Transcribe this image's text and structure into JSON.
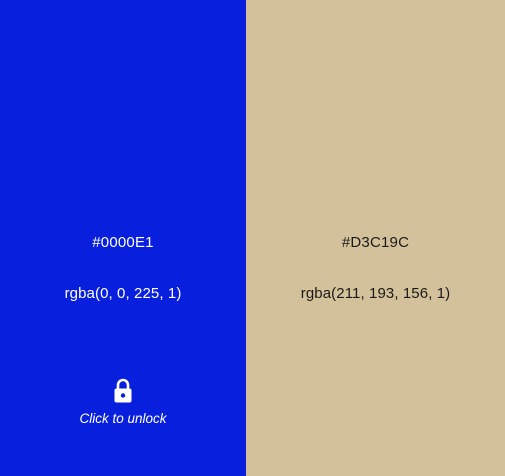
{
  "swatches": [
    {
      "hex": "#0000E1",
      "rgba": "rgba(0, 0, 225, 1)",
      "background_color": "#081fde",
      "text_color": "#ffffff",
      "lock": {
        "icon": "lock-icon",
        "label": "Click to unlock"
      }
    },
    {
      "hex": "#D3C19C",
      "rgba": "rgba(211, 193, 156, 1)",
      "background_color": "#d3c19c",
      "text_color": "#1c1a17"
    }
  ]
}
